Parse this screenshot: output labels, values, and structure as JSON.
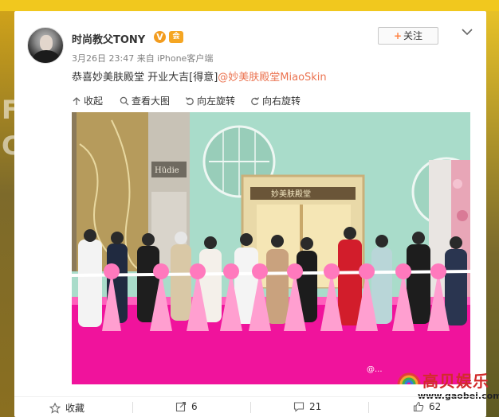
{
  "post": {
    "author": "时尚教父TONY",
    "verified_badge": "V",
    "vip_badge": "会",
    "meta": "3月26日 23:47 来自 iPhone客户端",
    "text": "恭喜妙美肤殿堂 开业大吉[得意]",
    "mention": "@妙美肤殿堂MiaoSkin",
    "follow_plus": "+",
    "follow_label": "关注"
  },
  "toolbar": {
    "collapse": "收起",
    "view_large": "查看大图",
    "rotate_left": "向左旋转",
    "rotate_right": "向右旋转"
  },
  "photo": {
    "store_sign_left": "Hüdie",
    "store_sign_door": "妙美肤殿堂",
    "weibo_watermark": "@..."
  },
  "footer": {
    "favorite": "收藏",
    "repost_count": "6",
    "comment_count": "21",
    "like_count": "62"
  },
  "site_watermark": {
    "name": "高贝娱乐",
    "url": "www.gaobei.com"
  },
  "colors": {
    "accent": "#eb7350",
    "follow_plus": "#ff8140",
    "badge_orange": "#f29c1f",
    "carpet_pink": "#f0139c",
    "wall_mint": "#a9dcca"
  }
}
